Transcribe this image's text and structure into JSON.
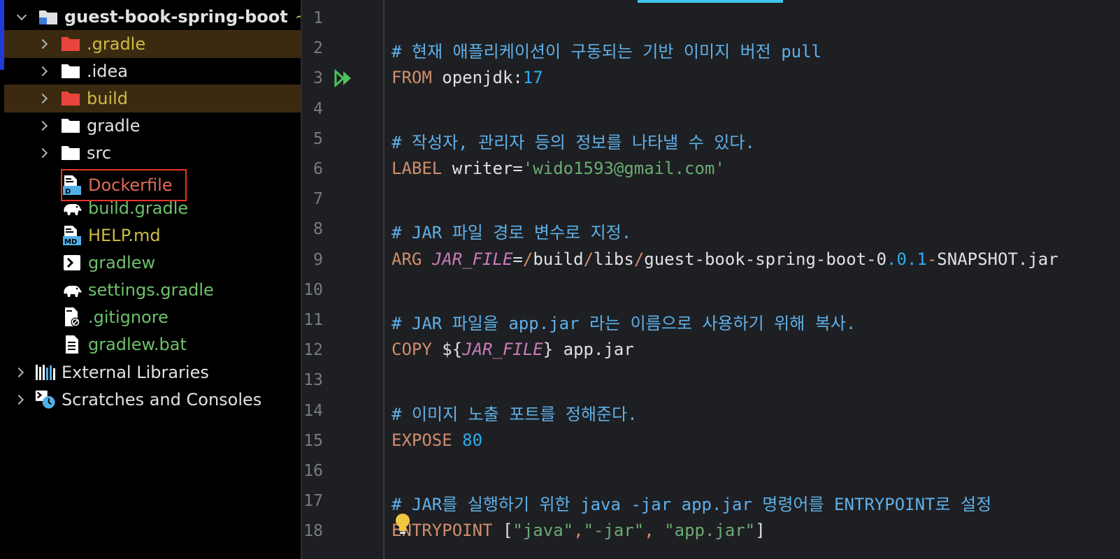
{
  "project_tree": {
    "root": {
      "label": "guest-book-spring-boot",
      "tail": "~"
    },
    "items": [
      {
        "label": ".gradle",
        "name": "folder-gradle-cache"
      },
      {
        "label": ".idea",
        "name": "folder-idea"
      },
      {
        "label": "build",
        "name": "folder-build"
      },
      {
        "label": "gradle",
        "name": "folder-gradle"
      },
      {
        "label": "src",
        "name": "folder-src"
      },
      {
        "label": "Dockerfile",
        "name": "file-dockerfile"
      },
      {
        "label": "build.gradle",
        "name": "file-build-gradle"
      },
      {
        "label": "HELP.md",
        "name": "file-help-md"
      },
      {
        "label": "gradlew",
        "name": "file-gradlew"
      },
      {
        "label": "settings.gradle",
        "name": "file-settings-gradle"
      },
      {
        "label": ".gitignore",
        "name": "file-gitignore"
      },
      {
        "label": "gradlew.bat",
        "name": "file-gradlew-bat"
      }
    ],
    "external_libraries": "External Libraries",
    "scratches": "Scratches and Consoles",
    "md_icon_text": "MD",
    "docker_icon_text": "D"
  },
  "editor": {
    "line_numbers": [
      "1",
      "2",
      "3",
      "4",
      "5",
      "6",
      "7",
      "8",
      "9",
      "10",
      "11",
      "12",
      "13",
      "14",
      "15",
      "16",
      "17",
      "18"
    ],
    "lines": [
      [],
      [
        {
          "t": "# 현재 애플리케이션이 구동되는 기반 이미지 버전 pull",
          "c": "comment"
        }
      ],
      [
        {
          "t": "FROM",
          "c": "kw"
        },
        {
          "t": " openjdk:",
          "c": "text"
        },
        {
          "t": "17",
          "c": "num"
        }
      ],
      [],
      [
        {
          "t": "# 작성자, 관리자 등의 정보를 나타낼 수 있다.",
          "c": "comment"
        }
      ],
      [
        {
          "t": "LABEL",
          "c": "kw"
        },
        {
          "t": " writer=",
          "c": "text"
        },
        {
          "t": "'wido1593@gmail.com'",
          "c": "str"
        }
      ],
      [],
      [
        {
          "t": "# JAR 파일 경로 변수로 지정.",
          "c": "comment"
        }
      ],
      [
        {
          "t": "ARG",
          "c": "kw"
        },
        {
          "t": " ",
          "c": "text"
        },
        {
          "t": "JAR_FILE",
          "c": "var"
        },
        {
          "t": "=",
          "c": "op"
        },
        {
          "t": "/",
          "c": "kw"
        },
        {
          "t": "build",
          "c": "text"
        },
        {
          "t": "/",
          "c": "kw"
        },
        {
          "t": "libs",
          "c": "text"
        },
        {
          "t": "/",
          "c": "kw"
        },
        {
          "t": "guest-book-spring-boot-0",
          "c": "text"
        },
        {
          "t": ".0.1",
          "c": "num"
        },
        {
          "t": "-",
          "c": "kw"
        },
        {
          "t": "SNAPSHOT.jar",
          "c": "text"
        }
      ],
      [],
      [
        {
          "t": "# JAR 파일을 app.jar 라는 이름으로 사용하기 위해 복사.",
          "c": "comment"
        }
      ],
      [
        {
          "t": "COPY",
          "c": "kw"
        },
        {
          "t": " ${",
          "c": "text"
        },
        {
          "t": "JAR_FILE",
          "c": "var"
        },
        {
          "t": "} app.jar",
          "c": "text"
        }
      ],
      [],
      [
        {
          "t": "# 이미지 노출 포트를 정해준다.",
          "c": "comment"
        }
      ],
      [
        {
          "t": "EXPOSE",
          "c": "kw"
        },
        {
          "t": " ",
          "c": "text"
        },
        {
          "t": "80",
          "c": "num"
        }
      ],
      [],
      [
        {
          "t": "# JAR를 실행하기 위한 java -jar app.jar 명령어를 ENTRYPOINT로 설정",
          "c": "comment"
        }
      ],
      [
        {
          "t": "ENTRYPOINT",
          "c": "kw"
        },
        {
          "t": " [",
          "c": "text"
        },
        {
          "t": "\"java\"",
          "c": "str"
        },
        {
          "t": ",",
          "c": "kw"
        },
        {
          "t": "\"-jar\"",
          "c": "str"
        },
        {
          "t": ", ",
          "c": "kw"
        },
        {
          "t": "\"app.jar\"",
          "c": "str"
        },
        {
          "t": "]",
          "c": "text"
        }
      ]
    ]
  }
}
